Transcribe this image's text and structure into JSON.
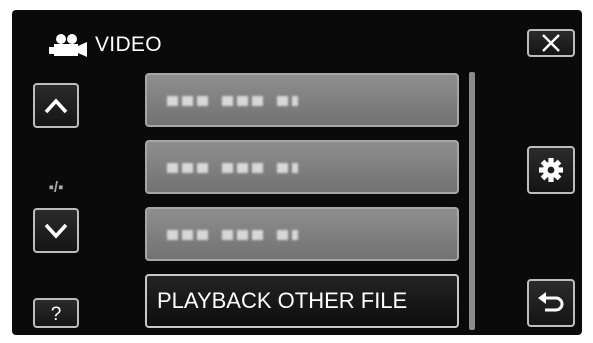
{
  "header": {
    "title": "VIDEO",
    "icon": "video-camera-icon"
  },
  "page_indicator": "▪/▪",
  "menu": {
    "items": [
      {
        "label": "",
        "state": "disabled"
      },
      {
        "label": "",
        "state": "disabled"
      },
      {
        "label": "",
        "state": "disabled"
      },
      {
        "label": "PLAYBACK OTHER FILE",
        "state": "enabled"
      }
    ]
  },
  "icons": {
    "close": "close-icon",
    "up": "chevron-up-icon",
    "down": "chevron-down-icon",
    "help": "question-icon",
    "settings": "gear-icon",
    "back": "return-icon"
  },
  "colors": {
    "background": "#0a0a0a",
    "text": "#ffffff",
    "disabled_item": "#7f7f7f"
  }
}
